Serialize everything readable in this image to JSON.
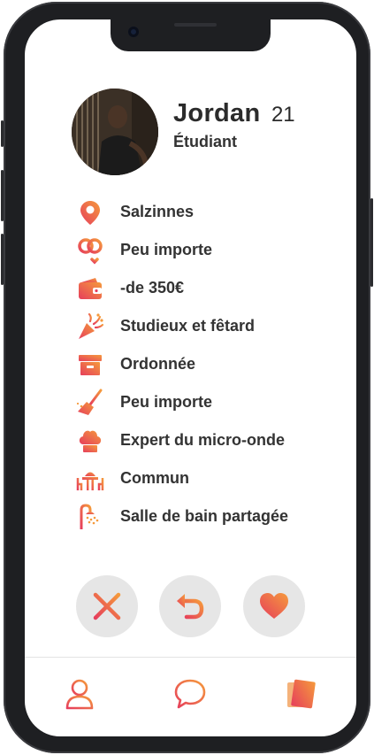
{
  "profile": {
    "name": "Jordan",
    "age": "21",
    "status": "Étudiant"
  },
  "attributes": [
    {
      "icon": "location-pin-icon",
      "label": "Salzinnes"
    },
    {
      "icon": "gender-symbols-icon",
      "label": "Peu importe"
    },
    {
      "icon": "wallet-icon",
      "label": "-de 350€"
    },
    {
      "icon": "party-popper-icon",
      "label": "Studieux et fêtard"
    },
    {
      "icon": "storage-box-icon",
      "label": "Ordonnée"
    },
    {
      "icon": "broom-icon",
      "label": "Peu importe"
    },
    {
      "icon": "chef-hat-icon",
      "label": "Expert du micro-onde"
    },
    {
      "icon": "dining-table-icon",
      "label": "Commun"
    },
    {
      "icon": "shower-icon",
      "label": "Salle de bain partagée"
    }
  ],
  "actions": [
    "dislike",
    "undo",
    "like"
  ],
  "nav": [
    "profile",
    "messages",
    "cards"
  ],
  "colors": {
    "accent_start": "#e63e5c",
    "accent_end": "#f59a3c",
    "button_bg": "#e6e6e6",
    "text": "#2b2b2b"
  }
}
